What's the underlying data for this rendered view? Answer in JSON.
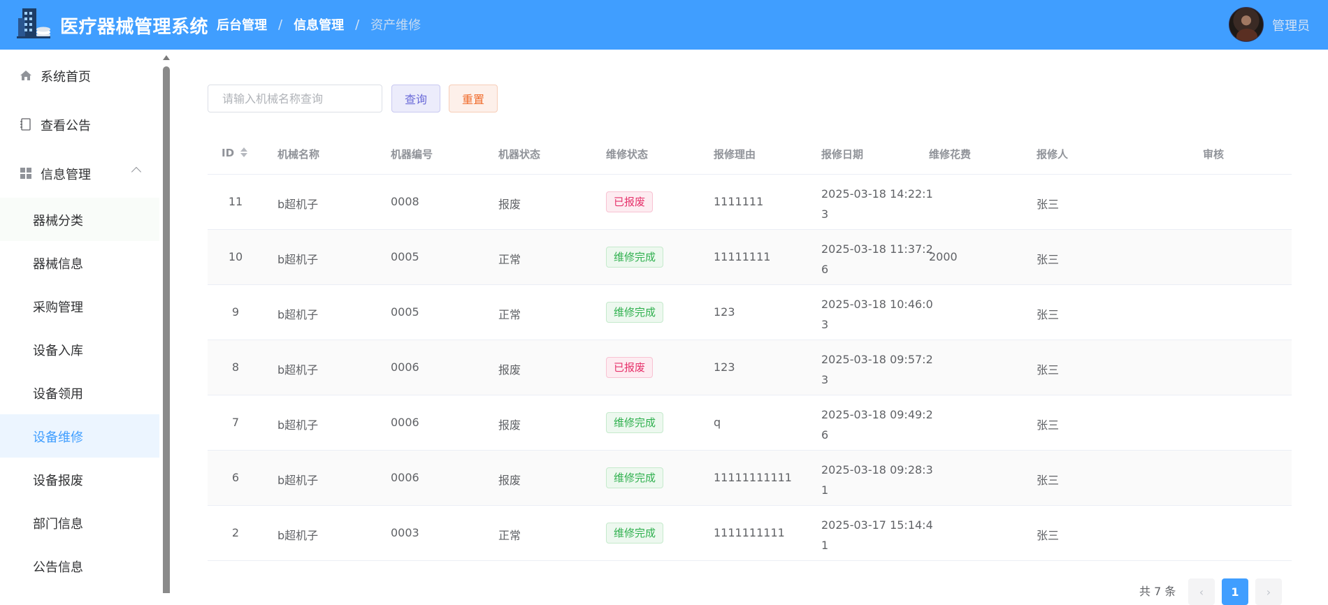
{
  "app": {
    "title": "医疗器械管理系统"
  },
  "breadcrumb": [
    "后台管理",
    "信息管理",
    "资产维修"
  ],
  "user": {
    "name": "管理员"
  },
  "sidebar": {
    "items": [
      {
        "label": "系统首页",
        "icon": "home-icon"
      },
      {
        "label": "查看公告",
        "icon": "notebook-icon"
      },
      {
        "label": "信息管理",
        "icon": "grid-icon",
        "expanded": true
      }
    ],
    "submenu": [
      {
        "label": "器械分类"
      },
      {
        "label": "器械信息"
      },
      {
        "label": "采购管理"
      },
      {
        "label": "设备入库"
      },
      {
        "label": "设备领用"
      },
      {
        "label": "设备维修",
        "active": true
      },
      {
        "label": "设备报废"
      },
      {
        "label": "部门信息"
      },
      {
        "label": "公告信息"
      }
    ]
  },
  "search": {
    "placeholder": "请输入机械名称查询",
    "query_label": "查询",
    "reset_label": "重置"
  },
  "table": {
    "columns": [
      "ID",
      "机械名称",
      "机器编号",
      "机器状态",
      "维修状态",
      "报修理由",
      "报修日期",
      "维修花费",
      "报修人",
      "审核"
    ],
    "rows": [
      {
        "id": "11",
        "name": "b超机子",
        "code": "0008",
        "machine_status": "报废",
        "repair_status": "已报废",
        "repair_type": "scrap",
        "reason": "1111111",
        "date": "2025-03-18 14:22:13",
        "cost": "",
        "reporter": "张三",
        "audit": ""
      },
      {
        "id": "10",
        "name": "b超机子",
        "code": "0005",
        "machine_status": "正常",
        "repair_status": "维修完成",
        "repair_type": "done",
        "reason": "11111111",
        "date": "2025-03-18 11:37:26",
        "cost": "2000",
        "reporter": "张三",
        "audit": ""
      },
      {
        "id": "9",
        "name": "b超机子",
        "code": "0005",
        "machine_status": "正常",
        "repair_status": "维修完成",
        "repair_type": "done",
        "reason": "123",
        "date": "2025-03-18 10:46:03",
        "cost": "",
        "reporter": "张三",
        "audit": ""
      },
      {
        "id": "8",
        "name": "b超机子",
        "code": "0006",
        "machine_status": "报废",
        "repair_status": "已报废",
        "repair_type": "scrap",
        "reason": "123",
        "date": "2025-03-18 09:57:23",
        "cost": "",
        "reporter": "张三",
        "audit": ""
      },
      {
        "id": "7",
        "name": "b超机子",
        "code": "0006",
        "machine_status": "报废",
        "repair_status": "维修完成",
        "repair_type": "done",
        "reason": "q",
        "date": "2025-03-18 09:49:26",
        "cost": "",
        "reporter": "张三",
        "audit": ""
      },
      {
        "id": "6",
        "name": "b超机子",
        "code": "0006",
        "machine_status": "报废",
        "repair_status": "维修完成",
        "repair_type": "done",
        "reason": "11111111111",
        "date": "2025-03-18 09:28:31",
        "cost": "",
        "reporter": "张三",
        "audit": ""
      },
      {
        "id": "2",
        "name": "b超机子",
        "code": "0003",
        "machine_status": "正常",
        "repair_status": "维修完成",
        "repair_type": "done",
        "reason": "1111111111",
        "date": "2025-03-17 15:14:41",
        "cost": "",
        "reporter": "张三",
        "audit": ""
      }
    ]
  },
  "pagination": {
    "total_label": "共 7 条",
    "current_page": "1",
    "prev_icon": "chevron-left-icon",
    "next_icon": "chevron-right-icon"
  },
  "colors": {
    "header": "#409eff",
    "active_menu_bg": "#ecf5ff",
    "tag_scrap": "#e6326b",
    "tag_done": "#2fb04e"
  }
}
